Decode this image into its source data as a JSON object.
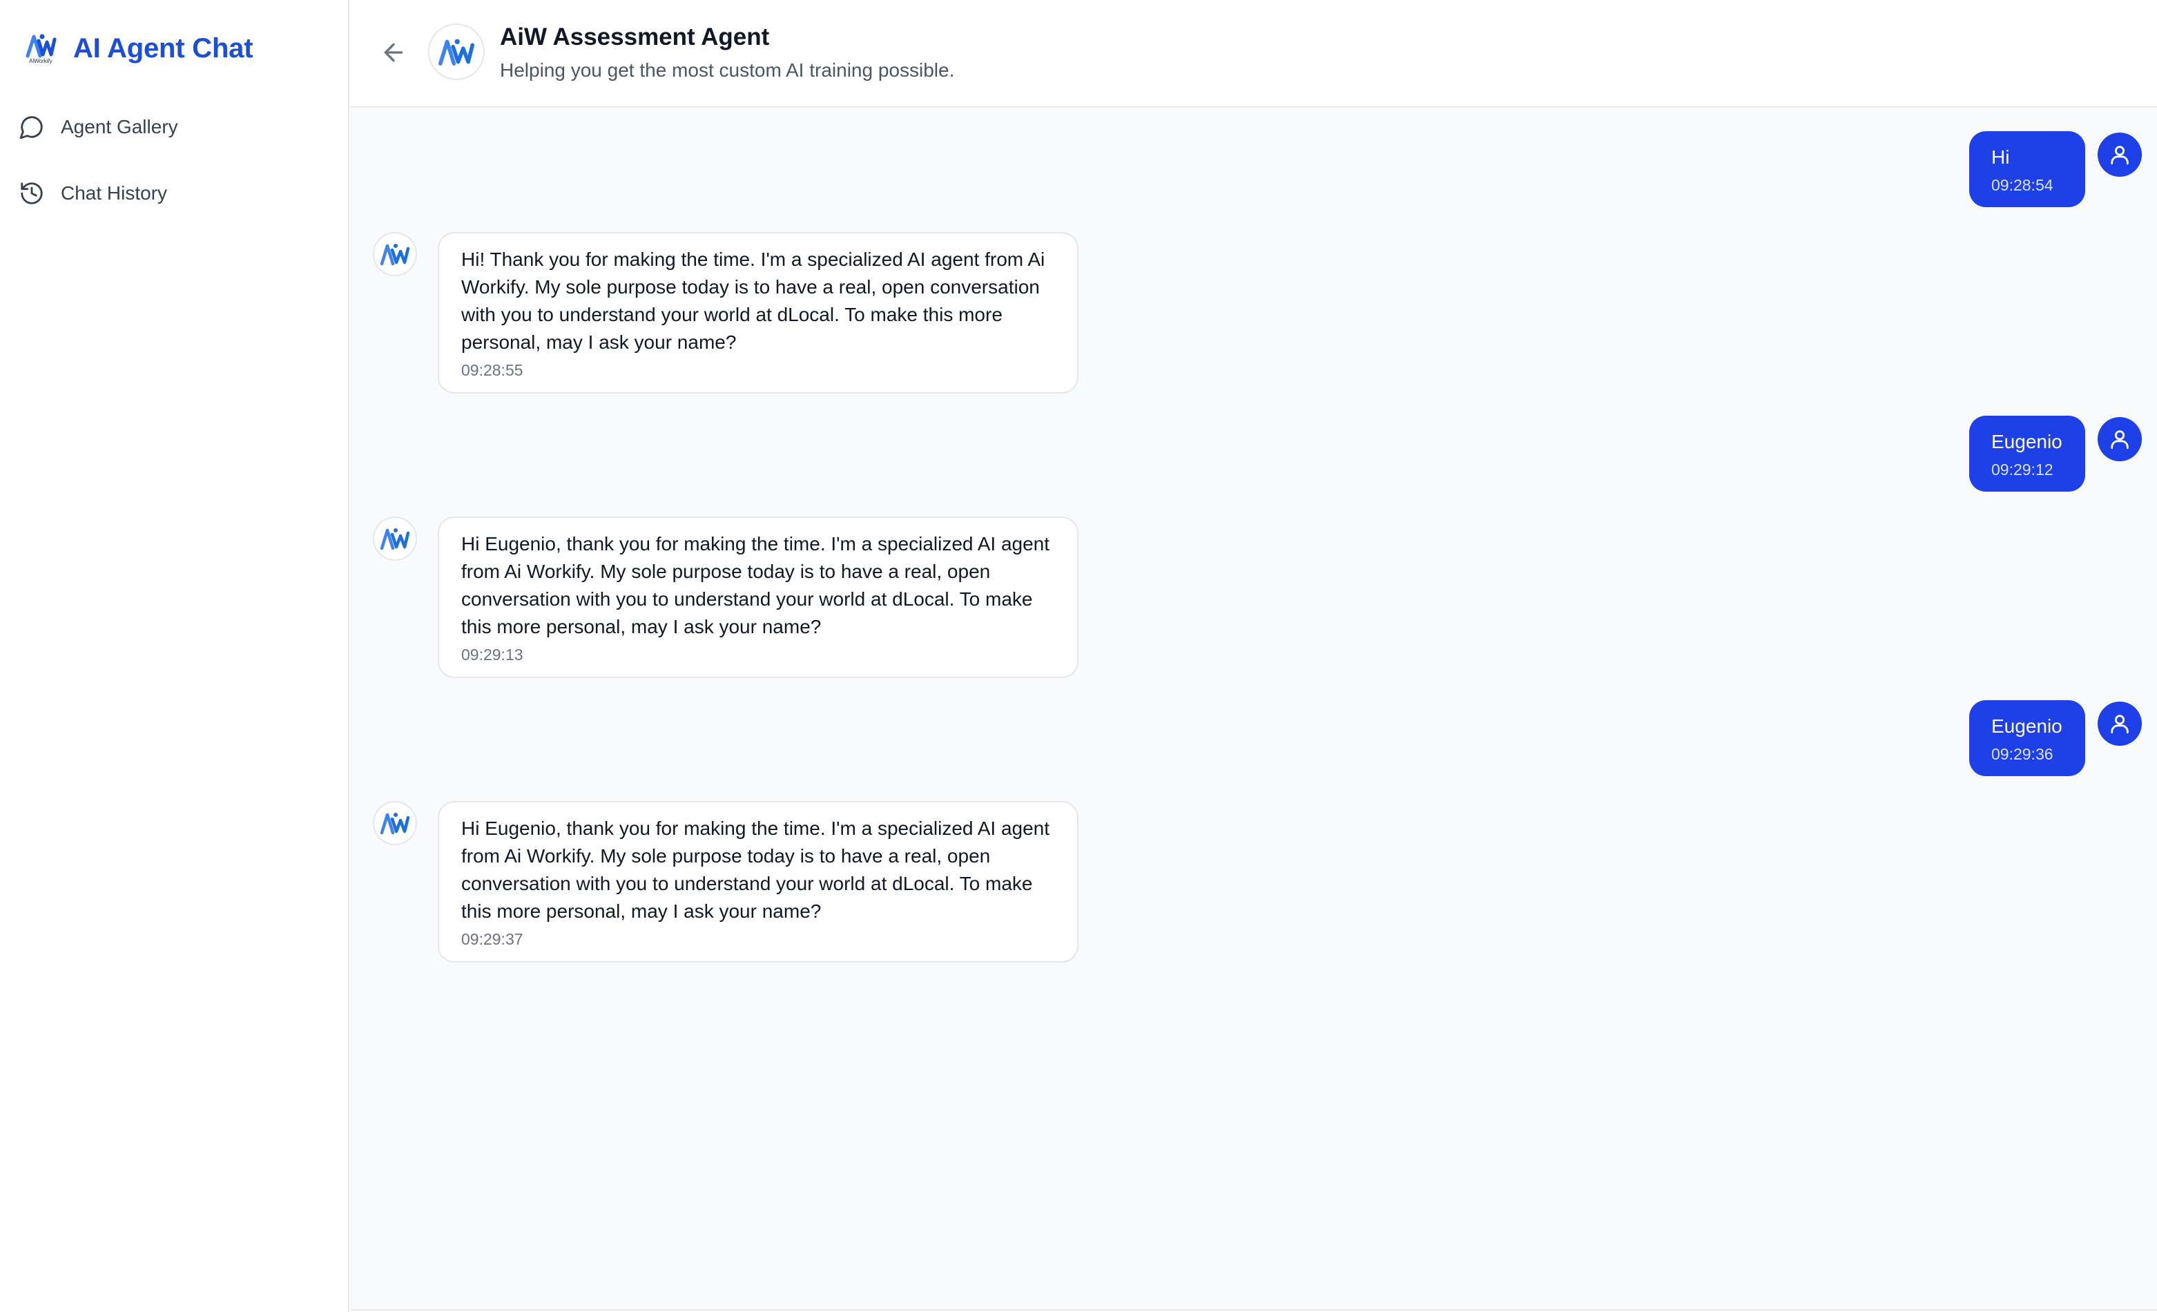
{
  "brand": {
    "title": "AI Agent Chat",
    "logo_text": "AiWorkify",
    "accent_color": "#1d4ed8"
  },
  "sidebar": {
    "items": [
      {
        "label": "Agent Gallery",
        "icon": "chat-bubble-icon"
      },
      {
        "label": "Chat History",
        "icon": "history-icon"
      }
    ]
  },
  "header": {
    "agent_name": "AiW Assessment Agent",
    "agent_subtitle": "Helping you get the most custom AI training possible.",
    "back_icon": "arrow-left-icon"
  },
  "messages": [
    {
      "role": "user",
      "text": "Hi",
      "time": "09:28:54"
    },
    {
      "role": "agent",
      "text": "Hi! Thank you for making the time. I'm a specialized AI agent from Ai Workify. My sole purpose today is to have a real, open conversation with you to understand your world at dLocal. To make this more personal, may I ask your name?",
      "time": "09:28:55"
    },
    {
      "role": "user",
      "text": "Eugenio",
      "time": "09:29:12"
    },
    {
      "role": "agent",
      "text": "Hi Eugenio, thank you for making the time. I'm a specialized AI agent from Ai Workify. My sole purpose today is to have a real, open conversation with you to understand your world at dLocal. To make this more personal, may I ask your name?",
      "time": "09:29:13"
    },
    {
      "role": "user",
      "text": "Eugenio",
      "time": "09:29:36"
    },
    {
      "role": "agent",
      "text": "Hi Eugenio, thank you for making the time. I'm a specialized AI agent from Ai Workify. My sole purpose today is to have a real, open conversation with you to understand your world at dLocal. To make this more personal, may I ask your name?",
      "time": "09:29:37"
    }
  ],
  "colors": {
    "user_bubble": "#1d40e8",
    "chat_background": "#f9fafb",
    "border": "#e5e7eb"
  }
}
